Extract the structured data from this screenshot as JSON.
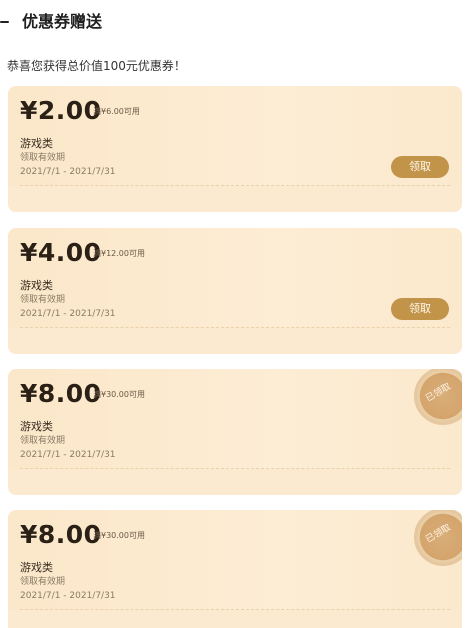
{
  "header": {
    "title": "优惠券赠送"
  },
  "congrats": "恭喜您获得总价值100元优惠券！",
  "coupons": [
    {
      "amount": "¥2.00",
      "condition": "满¥6.00可用",
      "category": "游戏类",
      "validity_label": "领取有效期",
      "validity_dates": "2021/7/1 - 2021/7/31",
      "action_label": "领取"
    },
    {
      "amount": "¥4.00",
      "condition": "满¥12.00可用",
      "category": "游戏类",
      "validity_label": "领取有效期",
      "validity_dates": "2021/7/1 - 2021/7/31",
      "action_label": "领取"
    },
    {
      "amount": "¥8.00",
      "condition": "满¥30.00可用",
      "category": "游戏类",
      "validity_label": "领取有效期",
      "validity_dates": "2021/7/1 - 2021/7/31",
      "stamp_label": "已领取"
    },
    {
      "amount": "¥8.00",
      "condition": "满¥30.00可用",
      "category": "游戏类",
      "validity_label": "领取有效期",
      "validity_dates": "2021/7/1 - 2021/7/31",
      "stamp_label": "已领取"
    }
  ],
  "colors": {
    "card_bg": "#fbe7c9",
    "button_bg": "#c2944a",
    "stamp_bg": "#d4a46c"
  }
}
